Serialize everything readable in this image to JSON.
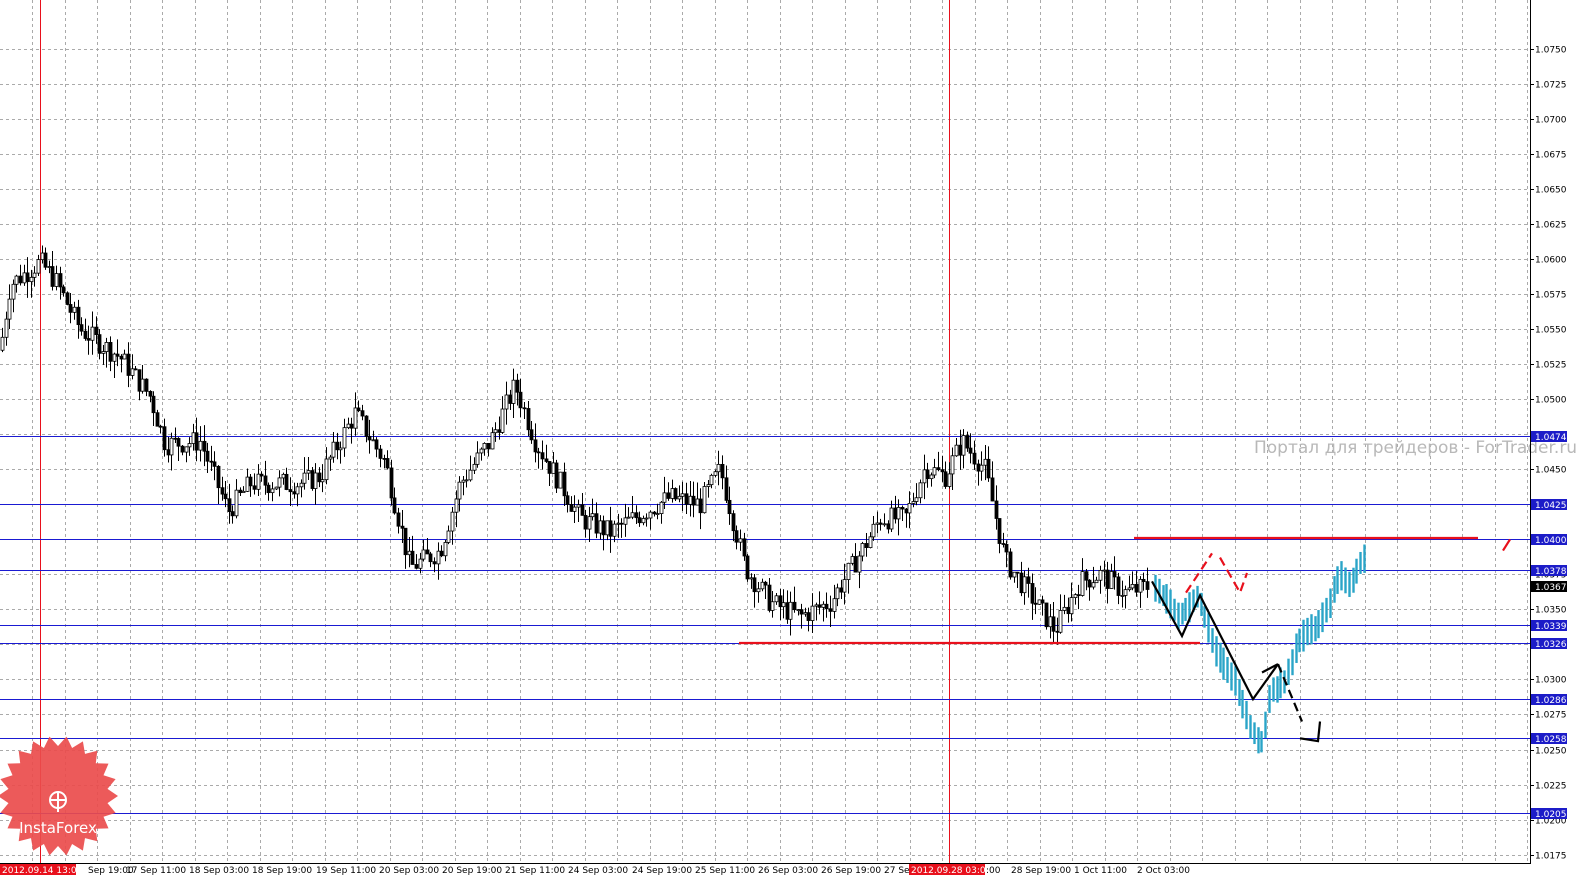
{
  "chart_data": {
    "type": "candlestick",
    "watermark": "Портал для трейдеров - ForTrader.ru",
    "logo": "InstaForex",
    "y_axis": {
      "range": [
        1.0169,
        1.0785
      ],
      "ticks": [
        "1.0750",
        "1.0725",
        "1.0700",
        "1.0675",
        "1.0650",
        "1.0625",
        "1.0600",
        "1.0575",
        "1.0550",
        "1.0525",
        "1.0500",
        "1.0475",
        "1.0450",
        "1.0425",
        "1.0400",
        "1.0375",
        "1.0350",
        "1.0325",
        "1.0300",
        "1.0275",
        "1.0250",
        "1.0225",
        "1.0200",
        "1.0175"
      ]
    },
    "x_axis": {
      "labels": [
        "Sep 19:00",
        "17 Sep 11:00",
        "18 Sep 03:00",
        "18 Sep 19:00",
        "19 Sep 11:00",
        "20 Sep 03:00",
        "20 Sep 19:00",
        "21 Sep 11:00",
        "24 Sep 03:00",
        "24 Sep 19:00",
        "25 Sep 11:00",
        "26 Sep 03:00",
        "26 Sep 19:00",
        "27 Sep",
        "28 Sep 19:00",
        "1 Oct 11:00",
        "2 Oct 03:00"
      ],
      "highlighted": [
        "2012.09.14 13:00",
        "2012.09.28 03:00"
      ],
      "highlighted_suffix": ":00"
    },
    "horizontal_levels": [
      {
        "label": "1.0474",
        "value": 1.0474
      },
      {
        "label": "1.0425",
        "value": 1.0425
      },
      {
        "label": "1.0400",
        "value": 1.04
      },
      {
        "label": "1.0378",
        "value": 1.0378
      },
      {
        "label": "1.0339",
        "value": 1.0339
      },
      {
        "label": "1.0326",
        "value": 1.0326
      },
      {
        "label": "1.0286",
        "value": 1.0286
      },
      {
        "label": "1.0258",
        "value": 1.0258
      },
      {
        "label": "1.0205",
        "value": 1.0205
      }
    ],
    "current_price": {
      "label": "1.0367",
      "value": 1.0367
    },
    "candle_path": [
      [
        0,
        1.0535
      ],
      [
        10,
        1.0582
      ],
      [
        40,
        1.0598
      ],
      [
        55,
        1.0585
      ],
      [
        80,
        1.055
      ],
      [
        120,
        1.053
      ],
      [
        150,
        1.0502
      ],
      [
        165,
        1.0468
      ],
      [
        200,
        1.047
      ],
      [
        228,
        1.042
      ],
      [
        250,
        1.044
      ],
      [
        300,
        1.044
      ],
      [
        320,
        1.0445
      ],
      [
        355,
        1.049
      ],
      [
        385,
        1.0455
      ],
      [
        410,
        1.038
      ],
      [
        440,
        1.0392
      ],
      [
        460,
        1.044
      ],
      [
        490,
        1.047
      ],
      [
        515,
        1.051
      ],
      [
        535,
        1.047
      ],
      [
        560,
        1.044
      ],
      [
        580,
        1.0415
      ],
      [
        610,
        1.0405
      ],
      [
        645,
        1.042
      ],
      [
        670,
        1.043
      ],
      [
        700,
        1.0425
      ],
      [
        720,
        1.045
      ],
      [
        745,
        1.038
      ],
      [
        770,
        1.0355
      ],
      [
        800,
        1.0345
      ],
      [
        830,
        1.0355
      ],
      [
        860,
        1.039
      ],
      [
        880,
        1.0415
      ],
      [
        905,
        1.0415
      ],
      [
        925,
        1.0452
      ],
      [
        945,
        1.0445
      ],
      [
        962,
        1.047
      ],
      [
        985,
        1.045
      ],
      [
        1005,
        1.0385
      ],
      [
        1030,
        1.036
      ],
      [
        1055,
        1.0335
      ],
      [
        1080,
        1.037
      ],
      [
        1100,
        1.0375
      ],
      [
        1125,
        1.0362
      ],
      [
        1150,
        1.0367
      ]
    ],
    "forecast_path": [
      [
        1155,
        1.0367
      ],
      [
        1180,
        1.0345
      ],
      [
        1198,
        1.036
      ],
      [
        1215,
        1.032
      ],
      [
        1235,
        1.03
      ],
      [
        1250,
        1.0265
      ],
      [
        1262,
        1.0255
      ],
      [
        1270,
        1.029
      ],
      [
        1285,
        1.03
      ],
      [
        1300,
        1.033
      ],
      [
        1318,
        1.034
      ],
      [
        1330,
        1.0355
      ],
      [
        1340,
        1.0375
      ],
      [
        1352,
        1.0368
      ],
      [
        1363,
        1.0388
      ]
    ],
    "vertical_markers_x": [
      40,
      949
    ],
    "trend_segments": [
      {
        "color": "#e8101c",
        "points": [
          [
            1134,
            1.0401
          ],
          [
            1478,
            1.0401
          ]
        ]
      },
      {
        "color": "#e8101c",
        "points": [
          [
            739,
            1.0326
          ],
          [
            1200,
            1.0326
          ]
        ]
      },
      {
        "color": "#000000",
        "points": [
          [
            1152,
            1.037
          ],
          [
            1182,
            1.0331
          ],
          [
            1200,
            1.036
          ],
          [
            1253,
            1.0286
          ],
          [
            1278,
            1.0311
          ]
        ]
      },
      {
        "color": "#000000",
        "dash": true,
        "points": [
          [
            1278,
            1.0311
          ],
          [
            1302,
            1.027
          ]
        ]
      },
      {
        "color": "#e8101c",
        "dash": true,
        "points": [
          [
            1186,
            1.0362
          ],
          [
            1212,
            1.039
          ]
        ]
      },
      {
        "color": "#e8101c",
        "dash": true,
        "points": [
          [
            1220,
            1.0387
          ],
          [
            1240,
            1.0362
          ],
          [
            1247,
            1.0376
          ]
        ]
      },
      {
        "color": "#e8101c",
        "points": [
          [
            1503,
            1.0392
          ],
          [
            1510,
            1.04
          ]
        ]
      }
    ]
  }
}
